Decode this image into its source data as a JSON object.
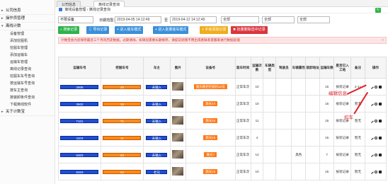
{
  "tabs": {
    "tab1": "公司信息",
    "tab2": "离线记录查询"
  },
  "sidebar": {
    "groups": [
      {
        "label": "公司信息"
      },
      {
        "label": "操作员管理"
      },
      {
        "label": "离线计数"
      }
    ],
    "items": [
      {
        "label": "设备管理"
      },
      {
        "label": "添加挖掘机"
      },
      {
        "label": "挖掘车管理"
      },
      {
        "label": "添加运输车"
      },
      {
        "label": "运输车管理"
      },
      {
        "label": "离线记录查询"
      },
      {
        "label": "挖掘车车号查询"
      },
      {
        "label": "按运输车号查询"
      },
      {
        "label": "按车主查询"
      },
      {
        "label": "按装卸条件查询"
      },
      {
        "label": "下载离线软件"
      }
    ],
    "last_group": "关于计数宝"
  },
  "breadcrumb": {
    "a": "离线设备管理",
    "b": "离线记录查询"
  },
  "filters": {
    "select": "不限设备",
    "date_label": "日期范围：",
    "start": "2019-04-05 14:12:49",
    "to": "至",
    "end": "2019-04-12 14:12:49",
    "v1": "全部",
    "v2": "全部",
    "v3": "全部"
  },
  "buttons": {
    "search": "搜索记录",
    "export": "导出记录",
    "enter": "进入装车模式",
    "enter_batch": "进入批量装车模式",
    "manual": "手动添加记录",
    "batch_delete": "批量删除选中记录"
  },
  "alert": "计数宝会为您保存最近三个月的历史数据，过期清除。如果您需要长期保存，请提前到我不用出或者联系客服来进行数据处理",
  "table": {
    "headers": [
      "运输车号",
      "挖掘车号",
      "车主",
      "图片",
      "设备号",
      "装车时间",
      "运输次数",
      "车辆类型",
      "驾驶员",
      "车辆属性",
      "装卸地址",
      "运输车数",
      "是否已入工地",
      "备注",
      "操作"
    ],
    "rows": [
      {
        "truck": "2906",
        "dig": "20",
        "owner": "未输入",
        "dev": "施光路挖挖掘机10号",
        "time": "正常车次",
        "n": "10",
        "qty": "15",
        "mode": "按装记录",
        "note": "2-1+"
      },
      {
        "truck": "3902",
        "dig": "39",
        "owner": "未输入",
        "dev": "施光15",
        "time": "正常车次",
        "n": "10",
        "qty": "15",
        "mode": "按装记录",
        "note": "暂无"
      },
      {
        "truck": "7101",
        "dig": "71",
        "owner": "未输入",
        "dev": "施光15",
        "time": "正常车次",
        "n": "11",
        "qty": "15",
        "mode": "按装记录",
        "note": "暂无"
      },
      {
        "truck": "1103",
        "dig": "11",
        "owner": "未输入",
        "dev": "施光15",
        "time": "正常车次",
        "n": "4",
        "qty": "15",
        "mode": "按装记录",
        "note": "暂无"
      },
      {
        "truck": "6303",
        "dig": "63",
        "owner": "未输入",
        "dev": "施光7",
        "time": "正常车次",
        "n": "14",
        "qty": "7",
        "mode": "按装记录",
        "note": "暂无",
        "prop": "黑色"
      },
      {
        "truck": "5203",
        "dig": "52",
        "owner": "老兄",
        "dev": "施光15",
        "time": "正常车次",
        "n": "10",
        "qty": "15",
        "mode": "按装记录",
        "note": "暂无"
      }
    ]
  },
  "annotations": {
    "edit": "编辑信息",
    "deduct": "扣车"
  },
  "colors": {
    "blue_plate": "#1f4fd8",
    "orange_plate": "#ff8a1c",
    "annotation": "#e0202c"
  }
}
